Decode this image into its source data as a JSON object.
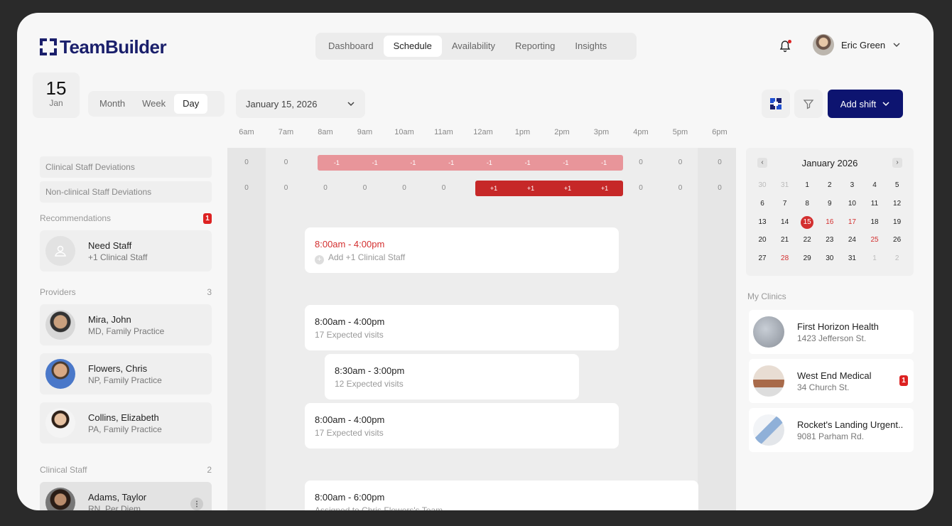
{
  "brand": {
    "name": "TeamBuilder"
  },
  "nav": [
    {
      "label": "Dashboard"
    },
    {
      "label": "Schedule",
      "active": true
    },
    {
      "label": "Availability"
    },
    {
      "label": "Reporting"
    },
    {
      "label": "Insights"
    }
  ],
  "user": {
    "name": "Eric Green"
  },
  "date_card": {
    "day": "15",
    "month": "Jan"
  },
  "view_tabs": [
    {
      "label": "Month"
    },
    {
      "label": "Week"
    },
    {
      "label": "Day",
      "active": true
    }
  ],
  "date_select": "January 15, 2026",
  "add_shift": "Add shift",
  "hours": [
    "6am",
    "7am",
    "8am",
    "9am",
    "10am",
    "11am",
    "12am",
    "1pm",
    "2pm",
    "3pm",
    "4pm",
    "5pm",
    "6pm"
  ],
  "deviations": {
    "clinical": {
      "label": "Clinical Staff Deviations",
      "values": [
        "0",
        "0",
        "-1",
        "-1",
        "-1",
        "-1",
        "-1",
        "-1",
        "-1",
        "-1",
        "0",
        "0",
        "0"
      ]
    },
    "nonclinical": {
      "label": "Non-clinical Staff Deviations",
      "values": [
        "0",
        "0",
        "0",
        "0",
        "0",
        "0",
        "+1",
        "+1",
        "+1",
        "+1",
        "0",
        "0",
        "0"
      ]
    }
  },
  "recommendations": {
    "label": "Recommendations",
    "count": "1",
    "card": {
      "title": "Need Staff",
      "sub": "+1 Clinical Staff"
    }
  },
  "providers": {
    "label": "Providers",
    "count": "3",
    "items": [
      {
        "name": "Mira, John",
        "role": "MD, Family Practice"
      },
      {
        "name": "Flowers, Chris",
        "role": "NP, Family Practice"
      },
      {
        "name": "Collins, Elizabeth",
        "role": "PA, Family Practice"
      }
    ]
  },
  "clinical_staff": {
    "label": "Clinical Staff",
    "count": "2",
    "items": [
      {
        "name": "Adams, Taylor",
        "role": "RN, Per Diem"
      }
    ]
  },
  "shifts": [
    {
      "time": "8:00am - 4:00pm",
      "sub": "Add +1 Clinical Staff"
    },
    {
      "time": "8:00am - 4:00pm",
      "sub": "17 Expected visits"
    },
    {
      "time": "8:30am - 3:00pm",
      "sub": "12 Expected visits"
    },
    {
      "time": "8:00am - 4:00pm",
      "sub": "17 Expected visits"
    },
    {
      "time": "8:00am - 6:00pm",
      "sub": "Assigned to Chris Flowers's Team"
    }
  ],
  "calendar": {
    "title": "January 2026",
    "weeks": [
      [
        "30",
        "31",
        "1",
        "2",
        "3",
        "4",
        "5"
      ],
      [
        "6",
        "7",
        "8",
        "9",
        "10",
        "11",
        "12"
      ],
      [
        "13",
        "14",
        "15",
        "16",
        "17",
        "18",
        "19"
      ],
      [
        "20",
        "21",
        "22",
        "23",
        "24",
        "25",
        "26"
      ],
      [
        "27",
        "28",
        "29",
        "30",
        "31",
        "1",
        "2"
      ]
    ],
    "selected": "15",
    "highlight_red": [
      "16",
      "17",
      "25",
      "28"
    ]
  },
  "my_clinics": {
    "label": "My Clinics",
    "items": [
      {
        "name": "First Horizon Health",
        "address": "1423 Jefferson St.",
        "badge": ""
      },
      {
        "name": "West End Medical",
        "address": "34 Church St.",
        "badge": "1"
      },
      {
        "name": "Rocket's Landing Urgent..",
        "address": "9081 Parham Rd.",
        "badge": ""
      }
    ]
  },
  "colors": {
    "brand": "#1a1f6b",
    "primary_button": "#0d1470",
    "alert": "#d32f2f",
    "deviation_negative": "#e8959a",
    "deviation_positive": "#c62828"
  }
}
